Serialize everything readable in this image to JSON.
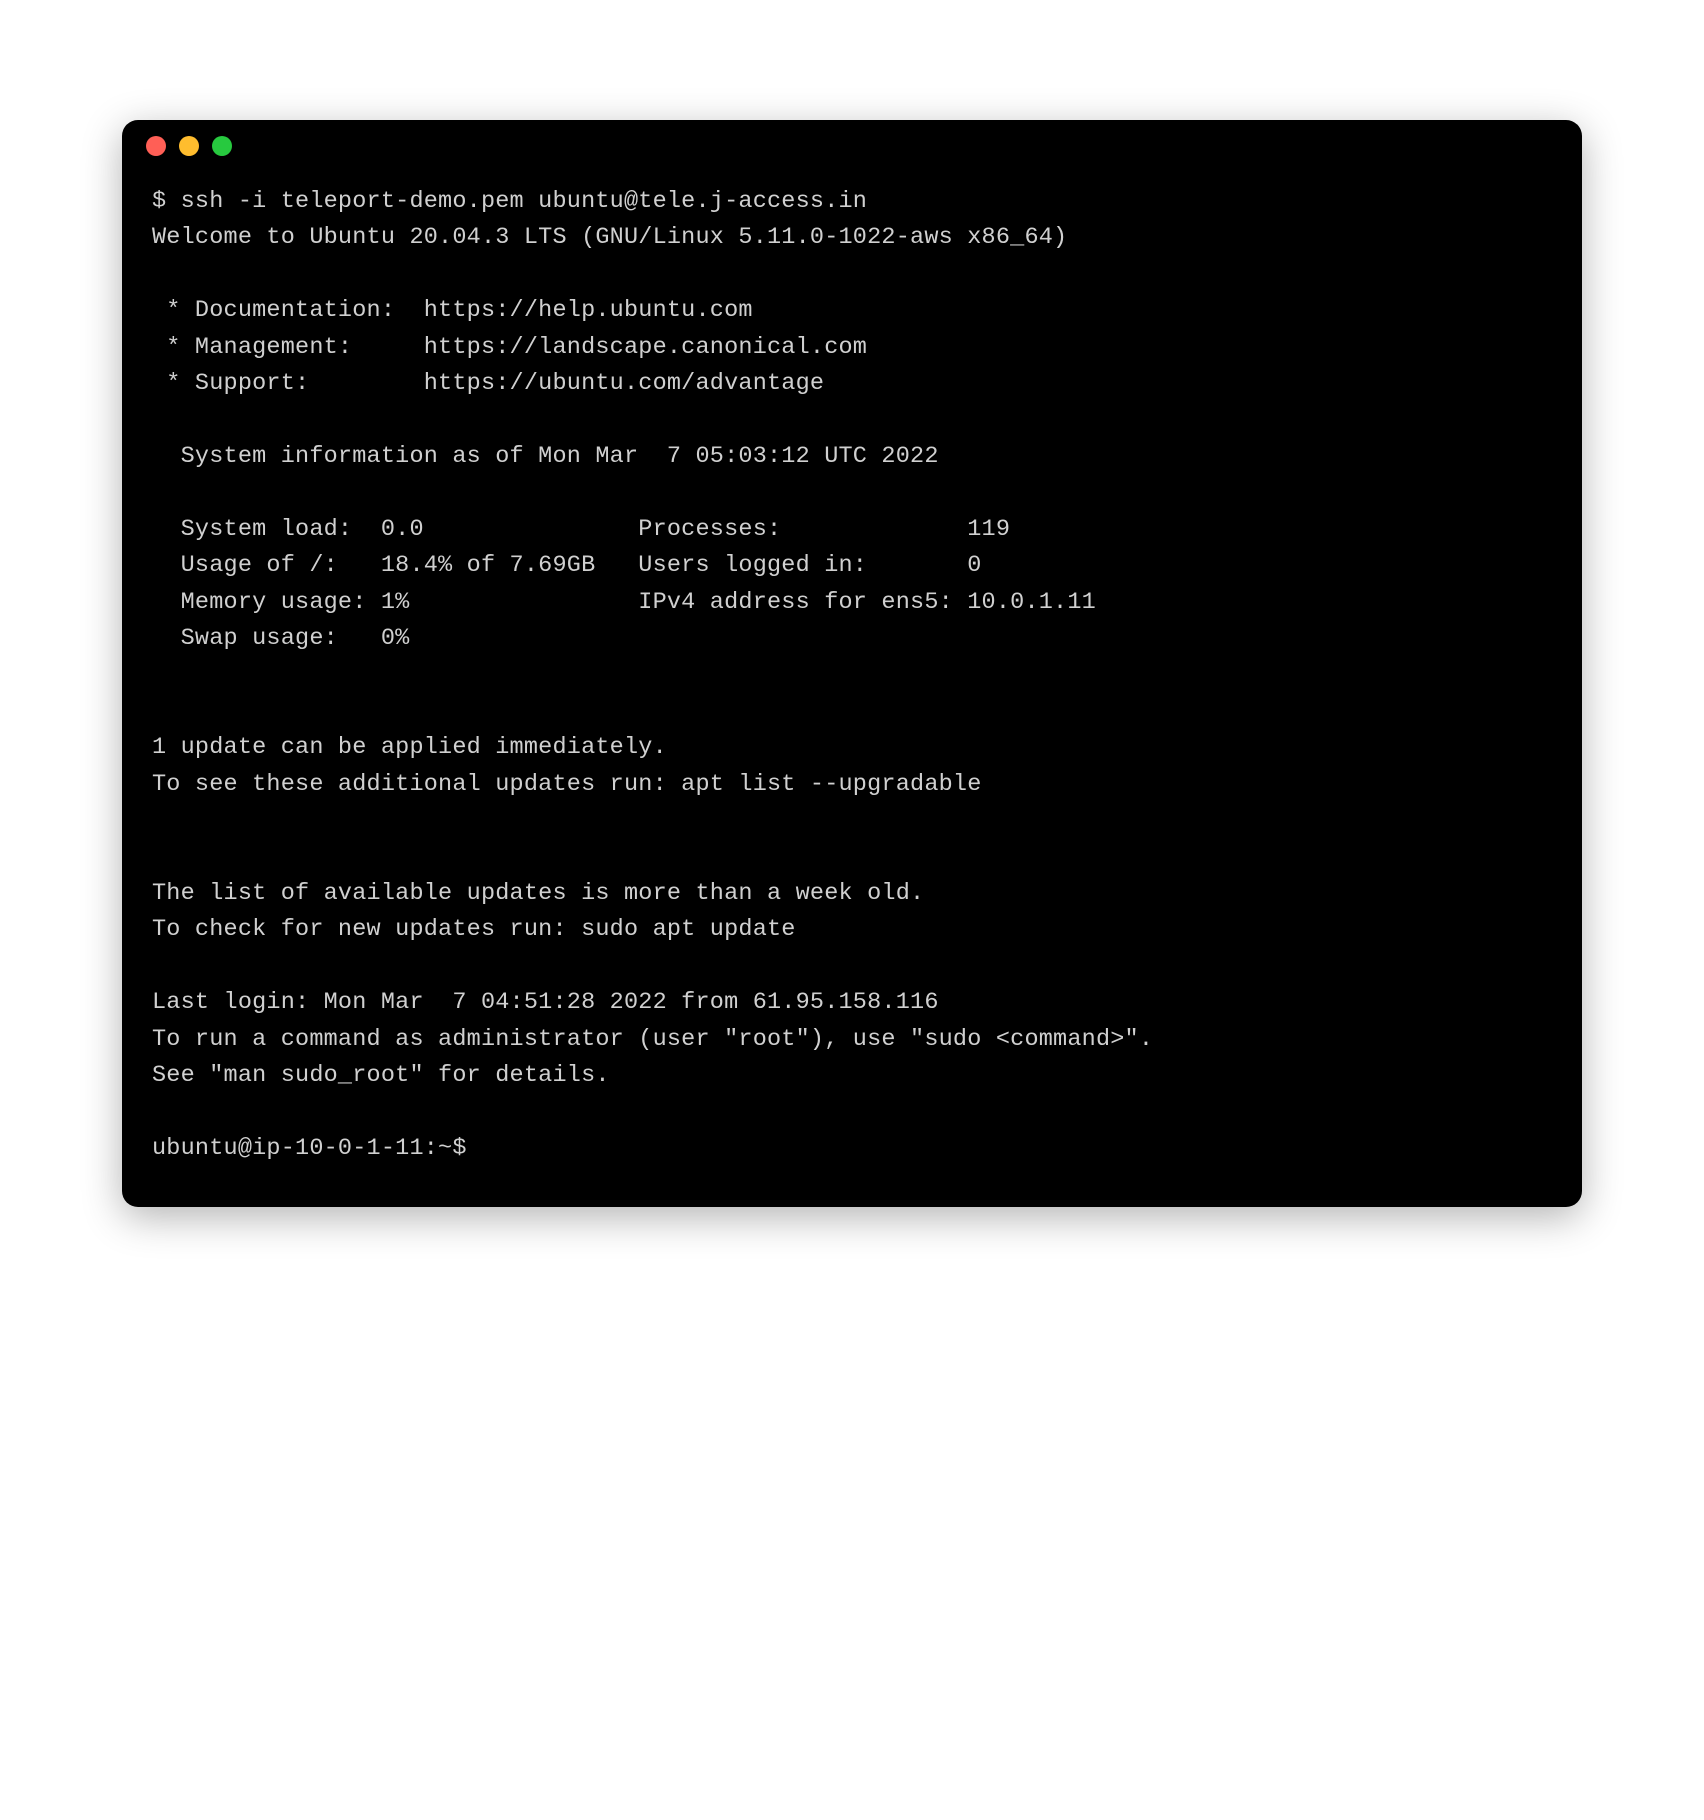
{
  "terminal": {
    "command_line": "$ ssh -i teleport-demo.pem ubuntu@tele.j-access.in",
    "welcome": "Welcome to Ubuntu 20.04.3 LTS (GNU/Linux 5.11.0-1022-aws x86_64)",
    "links": {
      "doc": " * Documentation:  https://help.ubuntu.com",
      "mgmt": " * Management:     https://landscape.canonical.com",
      "support": " * Support:        https://ubuntu.com/advantage"
    },
    "sysinfo_header": "  System information as of Mon Mar  7 05:03:12 UTC 2022",
    "stats": {
      "line1": "  System load:  0.0               Processes:             119",
      "line2": "  Usage of /:   18.4% of 7.69GB   Users logged in:       0",
      "line3": "  Memory usage: 1%                IPv4 address for ens5: 10.0.1.11",
      "line4": "  Swap usage:   0%"
    },
    "updates": {
      "line1": "1 update can be applied immediately.",
      "line2": "To see these additional updates run: apt list --upgradable"
    },
    "stale": {
      "line1": "The list of available updates is more than a week old.",
      "line2": "To check for new updates run: sudo apt update"
    },
    "last_login": "Last login: Mon Mar  7 04:51:28 2022 from 61.95.158.116",
    "sudo_hint1": "To run a command as administrator (user \"root\"), use \"sudo <command>\".",
    "sudo_hint2": "See \"man sudo_root\" for details.",
    "prompt": "ubuntu@ip-10-0-1-11:~$ "
  }
}
